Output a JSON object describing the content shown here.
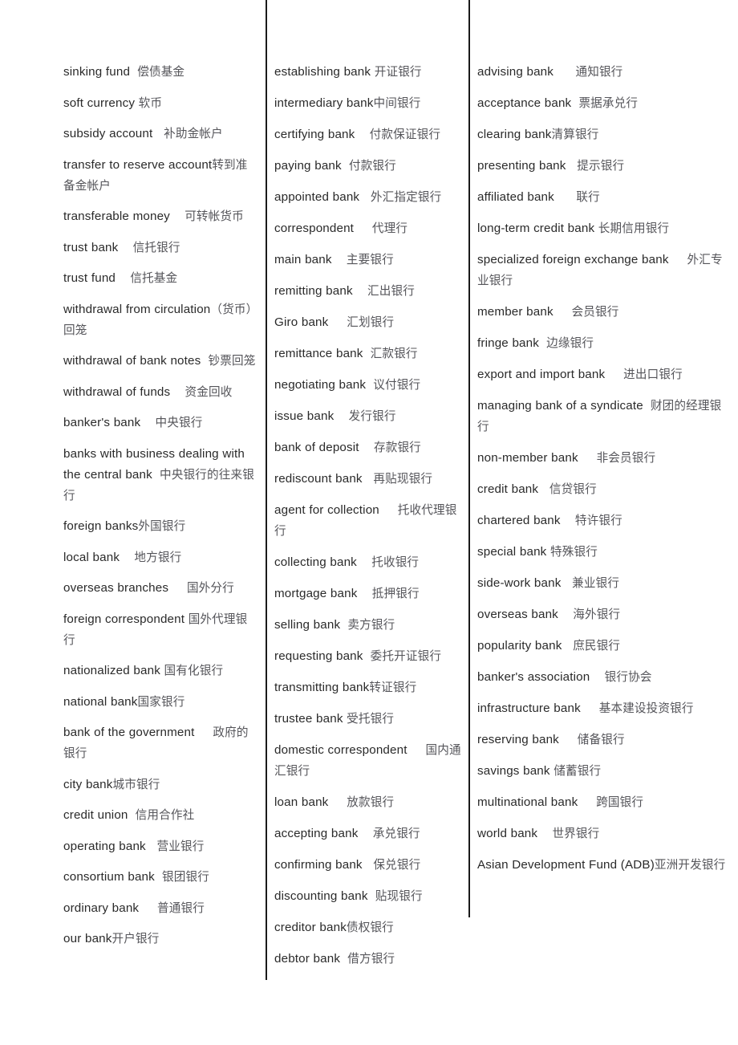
{
  "document": {
    "type": "bilingual-glossary",
    "title": "Banking terms English-Chinese glossary",
    "layout": "three-column",
    "colors": {
      "page_background": "#ffffff",
      "english_text": "#2a2a2a",
      "chinese_text": "#55555a",
      "divider": "#1a1a1a"
    }
  },
  "columns": [
    {
      "name": "column-1",
      "entries": [
        {
          "en": "sinking fund",
          "gap": "  ",
          "zh": "偿债基金"
        },
        {
          "en": "soft currency",
          "gap": " ",
          "zh": "软币"
        },
        {
          "en": "subsidy account",
          "gap": "   ",
          "zh": "补助金帐户"
        },
        {
          "en": "transfer to reserve account",
          "gap": "",
          "zh": "转到准备金帐户"
        },
        {
          "en": "transferable money",
          "gap": "    ",
          "zh": "可转帐货币"
        },
        {
          "en": "trust bank",
          "gap": "    ",
          "zh": "信托银行"
        },
        {
          "en": "trust fund",
          "gap": "    ",
          "zh": "信托基金"
        },
        {
          "en": "withdrawal from circulation",
          "gap": "",
          "zh": "（货币）回笼"
        },
        {
          "en": "withdrawal of bank notes",
          "gap": "  ",
          "zh": "钞票回笼"
        },
        {
          "en": "withdrawal of funds",
          "gap": "    ",
          "zh": "资金回收"
        },
        {
          "en": "banker's bank",
          "gap": "    ",
          "zh": "中央银行"
        },
        {
          "en": "banks with business dealing with the central bank",
          "gap": "  ",
          "zh": "中央银行的往来银行"
        },
        {
          "en": "foreign banks",
          "gap": "",
          "zh": "外国银行"
        },
        {
          "en": "local bank",
          "gap": "    ",
          "zh": "地方银行"
        },
        {
          "en": "overseas branches",
          "gap": "     ",
          "zh": "国外分行"
        },
        {
          "en": "foreign correspondent",
          "gap": " ",
          "zh": "国外代理银行"
        },
        {
          "en": "nationalized bank",
          "gap": " ",
          "zh": "国有化银行"
        },
        {
          "en": "national bank",
          "gap": "",
          "zh": "国家银行"
        },
        {
          "en": "bank of the government",
          "gap": "     ",
          "zh": "政府的银行"
        },
        {
          "en": "city bank",
          "gap": "",
          "zh": "城市银行"
        },
        {
          "en": "credit union",
          "gap": "  ",
          "zh": "信用合作社"
        },
        {
          "en": "operating bank",
          "gap": "   ",
          "zh": "营业银行"
        },
        {
          "en": "consortium bank",
          "gap": "  ",
          "zh": "银团银行"
        },
        {
          "en": "ordinary bank",
          "gap": "     ",
          "zh": "普通银行"
        },
        {
          "en": "our bank",
          "gap": "",
          "zh": "开户银行"
        }
      ]
    },
    {
      "name": "column-2",
      "entries": [
        {
          "en": "establishing bank",
          "gap": " ",
          "zh": "开证银行"
        },
        {
          "en": "intermediary bank",
          "gap": "",
          "zh": "中间银行"
        },
        {
          "en": "certifying bank",
          "gap": "    ",
          "zh": "付款保证银行"
        },
        {
          "en": "paying bank",
          "gap": "  ",
          "zh": "付款银行"
        },
        {
          "en": "appointed bank",
          "gap": "   ",
          "zh": "外汇指定银行"
        },
        {
          "en": "correspondent",
          "gap": "     ",
          "zh": "代理行"
        },
        {
          "en": "main bank",
          "gap": "    ",
          "zh": "主要银行"
        },
        {
          "en": "remitting bank",
          "gap": "    ",
          "zh": "汇出银行"
        },
        {
          "en": "Giro bank",
          "gap": "     ",
          "zh": "汇划银行"
        },
        {
          "en": "remittance bank",
          "gap": "  ",
          "zh": "汇款银行"
        },
        {
          "en": "negotiating bank",
          "gap": "  ",
          "zh": "议付银行"
        },
        {
          "en": "issue bank",
          "gap": "    ",
          "zh": "发行银行"
        },
        {
          "en": "bank of deposit",
          "gap": "    ",
          "zh": "存款银行"
        },
        {
          "en": "rediscount bank",
          "gap": "   ",
          "zh": "再贴现银行"
        },
        {
          "en": "agent for collection",
          "gap": "     ",
          "zh": "托收代理银行"
        },
        {
          "en": "collecting bank",
          "gap": "    ",
          "zh": "托收银行"
        },
        {
          "en": "mortgage bank",
          "gap": "    ",
          "zh": "抵押银行"
        },
        {
          "en": "selling bank",
          "gap": "  ",
          "zh": "卖方银行"
        },
        {
          "en": "requesting bank",
          "gap": "  ",
          "zh": "委托开证银行"
        },
        {
          "en": "transmitting bank",
          "gap": "",
          "zh": "转证银行"
        },
        {
          "en": "trustee bank",
          "gap": " ",
          "zh": "受托银行"
        },
        {
          "en": "domestic correspondent",
          "gap": "     ",
          "zh": "国内通汇银行"
        },
        {
          "en": "loan bank",
          "gap": "     ",
          "zh": "放款银行"
        },
        {
          "en": "accepting bank",
          "gap": "    ",
          "zh": "承兑银行"
        },
        {
          "en": "confirming bank",
          "gap": "   ",
          "zh": "保兑银行"
        },
        {
          "en": "discounting bank",
          "gap": "  ",
          "zh": "贴现银行"
        },
        {
          "en": "creditor bank",
          "gap": "",
          "zh": "债权银行"
        },
        {
          "en": "debtor bank",
          "gap": "  ",
          "zh": "借方银行"
        }
      ]
    },
    {
      "name": "column-3",
      "entries": [
        {
          "en": "advising bank",
          "gap": "      ",
          "zh": "通知银行"
        },
        {
          "en": "acceptance bank",
          "gap": "  ",
          "zh": "票据承兑行"
        },
        {
          "en": "clearing bank",
          "gap": "",
          "zh": "清算银行"
        },
        {
          "en": "presenting bank",
          "gap": "   ",
          "zh": "提示银行"
        },
        {
          "en": "affiliated bank",
          "gap": "      ",
          "zh": "联行"
        },
        {
          "en": "long-term credit bank",
          "gap": " ",
          "zh": "长期信用银行"
        },
        {
          "en": "specialized foreign exchange bank",
          "gap": "     ",
          "zh": "外汇专业银行"
        },
        {
          "en": "member bank",
          "gap": "     ",
          "zh": "会员银行"
        },
        {
          "en": "fringe bank",
          "gap": "  ",
          "zh": "边缘银行"
        },
        {
          "en": "export and import bank",
          "gap": "     ",
          "zh": "进出口银行"
        },
        {
          "en": "managing bank of a syndicate",
          "gap": "  ",
          "zh": "财团的经理银行"
        },
        {
          "en": "non-member bank",
          "gap": "     ",
          "zh": "非会员银行"
        },
        {
          "en": "credit bank",
          "gap": "   ",
          "zh": "信贷银行"
        },
        {
          "en": "chartered bank",
          "gap": "    ",
          "zh": "特许银行"
        },
        {
          "en": "special bank",
          "gap": " ",
          "zh": "特殊银行"
        },
        {
          "en": "side-work bank",
          "gap": "   ",
          "zh": "兼业银行"
        },
        {
          "en": "overseas bank",
          "gap": "    ",
          "zh": "海外银行"
        },
        {
          "en": "popularity bank",
          "gap": "   ",
          "zh": "庶民银行"
        },
        {
          "en": "banker's association",
          "gap": "    ",
          "zh": "银行协会"
        },
        {
          "en": "infrastructure bank",
          "gap": "     ",
          "zh": "基本建设投资银行"
        },
        {
          "en": "reserving bank",
          "gap": "     ",
          "zh": "储备银行"
        },
        {
          "en": "savings bank",
          "gap": " ",
          "zh": "储蓄银行"
        },
        {
          "en": "multinational bank",
          "gap": "     ",
          "zh": "跨国银行"
        },
        {
          "en": "world bank",
          "gap": "    ",
          "zh": "世界银行"
        },
        {
          "en": "Asian Development Fund (ADB)",
          "gap": "",
          "zh": "亚洲开发银行"
        }
      ]
    }
  ]
}
